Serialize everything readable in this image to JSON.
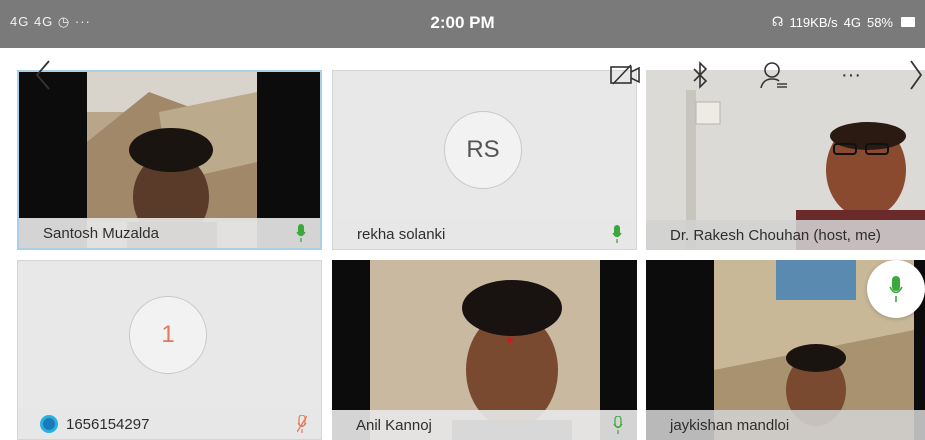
{
  "status_bar": {
    "left_icons": "4G 4G ◷ ···",
    "time": "2:00 PM",
    "network": "119KB/s",
    "signal": "4G",
    "battery": "58%"
  },
  "toolbar": {
    "back_icon": "chevron-left",
    "camera_off_icon": "video-off",
    "bluetooth_icon": "bluetooth",
    "participants_icon": "participants",
    "more_icon": "more",
    "next_icon": "chevron-right"
  },
  "participants": [
    {
      "name": "Santosh Muzalda",
      "mic": "on",
      "video": true
    },
    {
      "name": "rekha solanki",
      "mic": "on",
      "initials": "RS",
      "video": false
    },
    {
      "name": "Dr. Rakesh Chouhan (host, me)",
      "mic": "on",
      "video": true
    },
    {
      "name": "1656154297",
      "mic": "muted",
      "initials": "1",
      "video": false
    },
    {
      "name": "Anil Kannoj",
      "mic": "on",
      "video": true
    },
    {
      "name": "jaykishan mandloi",
      "mic": "on",
      "video": true
    }
  ],
  "colors": {
    "status_bg": "#7a7a7a",
    "mic_on": "#3aa83a",
    "mic_muted": "#e07a5a",
    "active_border": "#aacfe6"
  }
}
